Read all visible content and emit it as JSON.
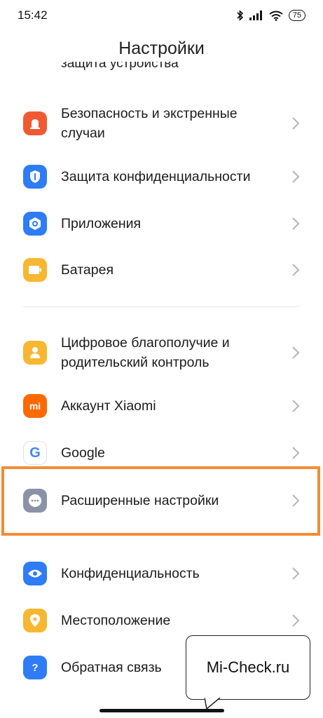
{
  "status_bar": {
    "time": "15:42",
    "battery": "75"
  },
  "header": {
    "title": "Настройки"
  },
  "cut_item": {
    "label": "защита устройства"
  },
  "items": [
    {
      "label": "Безопасность и экстренные случаи",
      "icon": "alarm-icon",
      "color": "#f05a32"
    },
    {
      "label": "Защита конфиденциальности",
      "icon": "shield-icon",
      "color": "#2e7cf6"
    },
    {
      "label": "Приложения",
      "icon": "gear-icon",
      "color": "#2e7cf6"
    },
    {
      "label": "Батарея",
      "icon": "battery-icon",
      "color": "#f7b731"
    },
    {
      "label": "Цифровое благополучие и родительский контроль",
      "icon": "person-icon",
      "color": "#f7b731"
    },
    {
      "label": "Аккаунт Xiaomi",
      "icon": "mi-icon",
      "color": "#ff6900",
      "icon_text": "mi"
    },
    {
      "label": "Google",
      "icon": "google-icon",
      "color": "#ffffff",
      "icon_text": "G"
    },
    {
      "label": "Расширенные настройки",
      "icon": "more-icon",
      "color": "#8a92a8"
    },
    {
      "label": "Конфиденциальность",
      "icon": "eye-icon",
      "color": "#2e7cf6"
    },
    {
      "label": "Местоположение",
      "icon": "location-pin-icon",
      "color": "#f7b731"
    },
    {
      "label": "Обратная связь",
      "icon": "feedback-icon",
      "color": "#2e7cf6",
      "icon_text": "?"
    }
  ],
  "watermark": {
    "text": "Mi-Check.ru"
  },
  "highlight_color": "#f28c35"
}
